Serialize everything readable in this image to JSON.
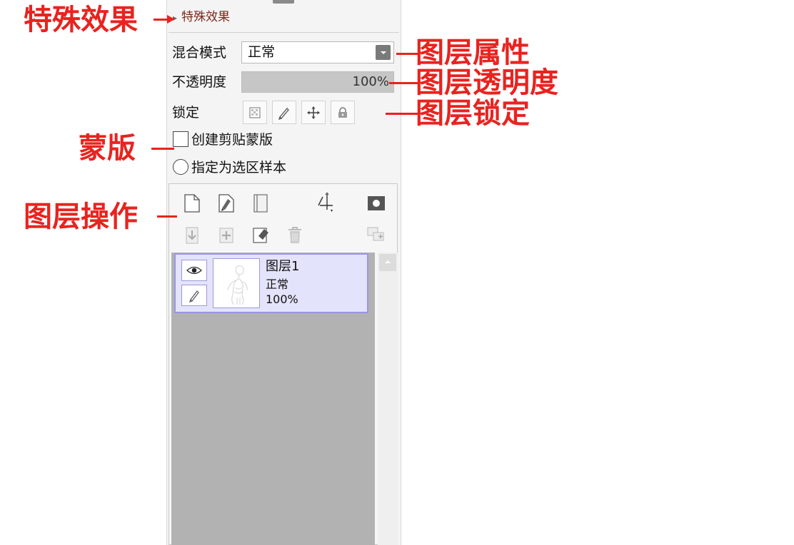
{
  "panel": {
    "effects_label": "特殊效果",
    "blend_mode": {
      "label": "混合模式",
      "value": "正常"
    },
    "opacity": {
      "label": "不透明度",
      "value_text": "100%",
      "fraction": 1.0
    },
    "lock": {
      "label": "锁定",
      "buttons": [
        "lock-transparency-icon",
        "lock-paint-icon",
        "lock-move-icon",
        "lock-all-icon"
      ]
    },
    "clipping": {
      "label": "创建剪贴蒙版",
      "checked": false
    },
    "selection_source": {
      "label": "指定为选区样本",
      "selected": false
    },
    "toolbar_row1": [
      "new-layer-icon",
      "new-linework-layer-icon",
      "new-folder-icon",
      "transfer-down-icon",
      "mask-icon"
    ],
    "toolbar_row2": [
      "merge-down-icon",
      "merge-all-icon",
      "clear-layer-icon",
      "delete-layer-icon",
      "merge-group-icon"
    ],
    "layers": [
      {
        "name": "图层1",
        "mode": "正常",
        "opacity": "100%",
        "visible": true,
        "selected": true
      }
    ]
  },
  "annotations": {
    "effects": "特殊效果",
    "properties": "图层属性",
    "opacity": "图层透明度",
    "lock": "图层锁定",
    "mask": "蒙版",
    "operations": "图层操作"
  },
  "colors": {
    "annotation": "#e8231f",
    "selected_layer_bg": "#e3e3fb",
    "selected_layer_border": "#9b95e6",
    "list_bg": "#b2b2b2"
  }
}
